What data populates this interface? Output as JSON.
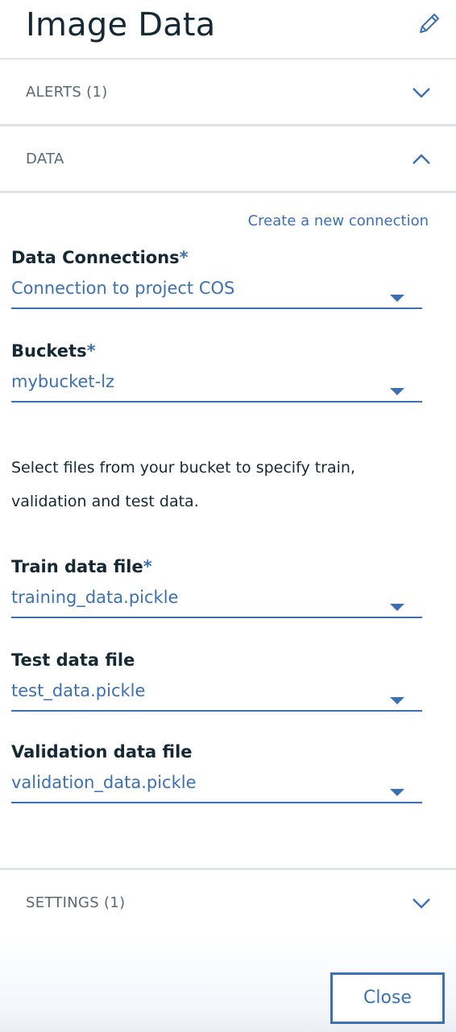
{
  "header": {
    "title": "Image Data"
  },
  "sections": {
    "alerts": {
      "label": "ALERTS (1)"
    },
    "data": {
      "label": "DATA"
    },
    "settings": {
      "label": "SETTINGS (1)"
    }
  },
  "data": {
    "create_connection_link": "Create a new connection",
    "required_marker": "*",
    "data_connections": {
      "label": "Data Connections",
      "value": "Connection to project COS"
    },
    "buckets": {
      "label": "Buckets",
      "value": "mybucket-lz"
    },
    "help_line1": "Select files from your bucket to specify train,",
    "help_line2": "validation and test data.",
    "train_file": {
      "label": "Train data file",
      "value": "training_data.pickle"
    },
    "test_file": {
      "label": "Test data file",
      "value": "test_data.pickle"
    },
    "validation_file": {
      "label": "Validation data file",
      "value": "validation_data.pickle"
    }
  },
  "footer": {
    "close_label": "Close"
  },
  "colors": {
    "accent": "#3d70b2",
    "text": "#152935",
    "muted": "#5a6872",
    "divider": "#dfe3e6"
  }
}
